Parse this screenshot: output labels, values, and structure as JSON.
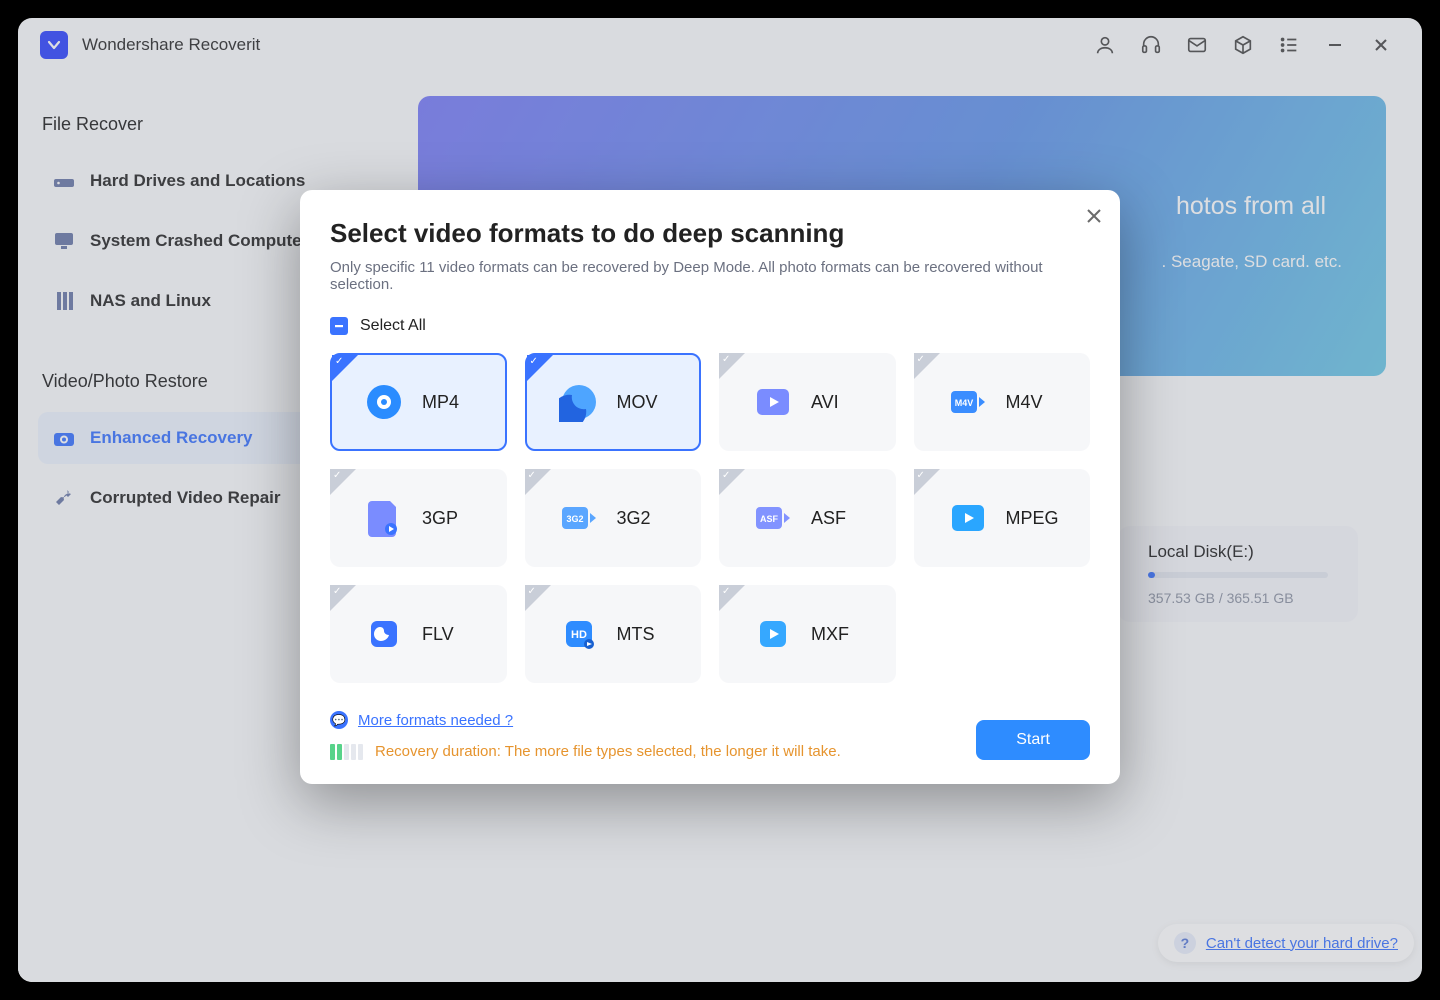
{
  "app": {
    "name": "Wondershare Recoverit"
  },
  "sidebar": {
    "section1": "File Recover",
    "items1": [
      {
        "label": "Hard Drives and Locations"
      },
      {
        "label": "System Crashed Computer"
      },
      {
        "label": "NAS and Linux"
      }
    ],
    "section2": "Video/Photo Restore",
    "items2": [
      {
        "label": "Enhanced Recovery"
      },
      {
        "label": "Corrupted Video Repair"
      }
    ]
  },
  "hero": {
    "title_fragment": "hotos from all",
    "sub_fragment": ". Seagate, SD card. etc."
  },
  "disk": {
    "name": "Local Disk(E:)",
    "usage": "357.53 GB / 365.51 GB"
  },
  "help": {
    "text": "Can't detect your hard drive?"
  },
  "modal": {
    "title": "Select video formats to do deep scanning",
    "description": "Only specific 11 video formats can be recovered by Deep Mode. All photo formats can be recovered without selection.",
    "select_all": "Select All",
    "formats": [
      {
        "label": "MP4",
        "selected": true
      },
      {
        "label": "MOV",
        "selected": true
      },
      {
        "label": "AVI",
        "selected": false
      },
      {
        "label": "M4V",
        "selected": false
      },
      {
        "label": "3GP",
        "selected": false
      },
      {
        "label": "3G2",
        "selected": false
      },
      {
        "label": "ASF",
        "selected": false
      },
      {
        "label": "MPEG",
        "selected": false
      },
      {
        "label": "FLV",
        "selected": false
      },
      {
        "label": "MTS",
        "selected": false
      },
      {
        "label": "MXF",
        "selected": false
      }
    ],
    "more_link": "More formats needed ?",
    "duration_note": "Recovery duration: The more file types selected, the longer it will take.",
    "start": "Start"
  }
}
